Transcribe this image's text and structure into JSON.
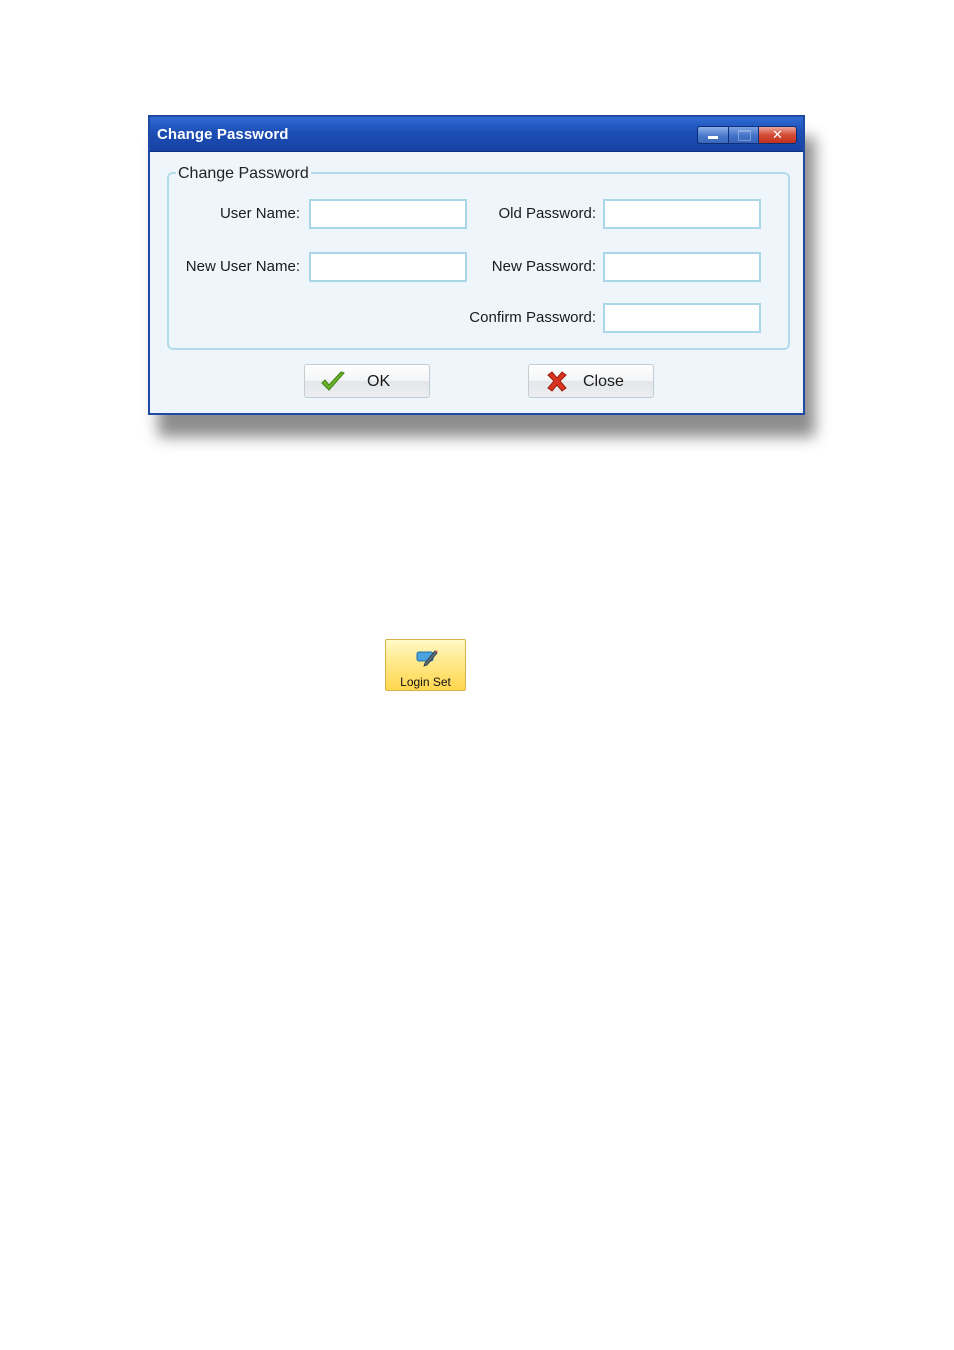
{
  "dialog": {
    "title": "Change Password",
    "window_controls": {
      "minimize_icon": "minimize-icon",
      "maximize_icon": "maximize-icon",
      "close_icon": "close-icon",
      "close_glyph": "✕"
    },
    "group": {
      "legend": "Change Password",
      "fields": {
        "user_name": {
          "label": "User Name:",
          "value": ""
        },
        "old_password": {
          "label": "Old Password:",
          "value": ""
        },
        "new_user_name": {
          "label": "New User Name:",
          "value": ""
        },
        "new_password": {
          "label": "New Password:",
          "value": ""
        },
        "confirm_password": {
          "label": "Confirm Password:",
          "value": ""
        }
      }
    },
    "buttons": {
      "ok": {
        "label": "OK",
        "icon": "checkmark-icon"
      },
      "close": {
        "label": "Close",
        "icon": "red-x-icon"
      }
    }
  },
  "login_set_button": {
    "label": "Login Set",
    "icon": "edit-pen-icon"
  },
  "colors": {
    "titlebar": "#1c4eb5",
    "dialog_background": "#eef6fb",
    "input_border": "#a9d6e8",
    "close_button": "#d44b36",
    "login_set_background": "#ffe98a"
  }
}
